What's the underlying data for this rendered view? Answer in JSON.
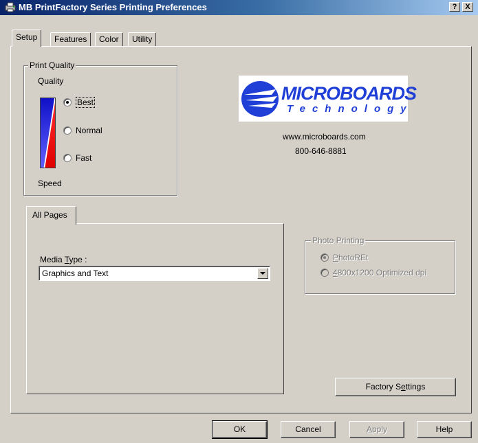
{
  "window": {
    "title": "MB PrintFactory Series Printing Preferences",
    "help_button": "?",
    "close_button": "X"
  },
  "tabs": [
    "Setup",
    "Features",
    "Color",
    "Utility"
  ],
  "active_tab": "Setup",
  "print_quality": {
    "group_label": "Print Quality",
    "quality_label": "Quality",
    "speed_label": "Speed",
    "options": [
      {
        "label": "Best",
        "checked": true
      },
      {
        "label": "Normal",
        "checked": false
      },
      {
        "label": "Fast",
        "checked": false
      }
    ]
  },
  "brand": {
    "logo_text": "MICROBOARDS",
    "logo_subtext": "Technology",
    "website": "www.microboards.com",
    "phone": "800-646-8881",
    "colors": {
      "logo_blue": "#1f3fd6"
    }
  },
  "pages": {
    "tab_label": "All Pages",
    "media_type_label_prefix": "Media ",
    "media_type_label_access": "T",
    "media_type_label_suffix": "ype :",
    "media_type_value": "Graphics and Text"
  },
  "photo_printing": {
    "group_label": "Photo Printing",
    "options": [
      {
        "access": "P",
        "rest": "hotoREt",
        "checked": true
      },
      {
        "access": "4",
        "rest": "800x1200 Optimized dpi",
        "checked": false
      }
    ]
  },
  "factory_settings": {
    "prefix": "Factory S",
    "access": "e",
    "suffix": "ttings"
  },
  "footer_buttons": {
    "ok": "OK",
    "cancel": "Cancel",
    "apply_access": "A",
    "apply_rest": "pply",
    "help": "Help"
  }
}
